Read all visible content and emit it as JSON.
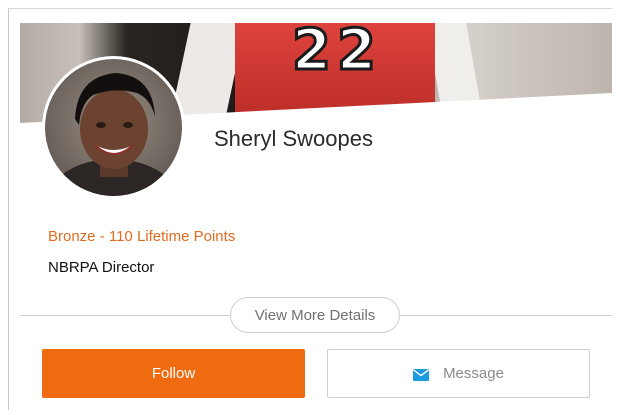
{
  "profile": {
    "name": "Sheryl Swoopes",
    "points_label": "Bronze - 110 Lifetime Points",
    "title": "NBRPA Director",
    "cover_jersey_number": "22"
  },
  "actions": {
    "view_more_label": "View More Details",
    "follow_label": "Follow",
    "message_label": "Message"
  },
  "icons": {
    "message": "envelope-icon"
  },
  "colors": {
    "accent": "#f06a10",
    "points_text": "#e06b1f",
    "message_icon": "#1e9be0"
  }
}
